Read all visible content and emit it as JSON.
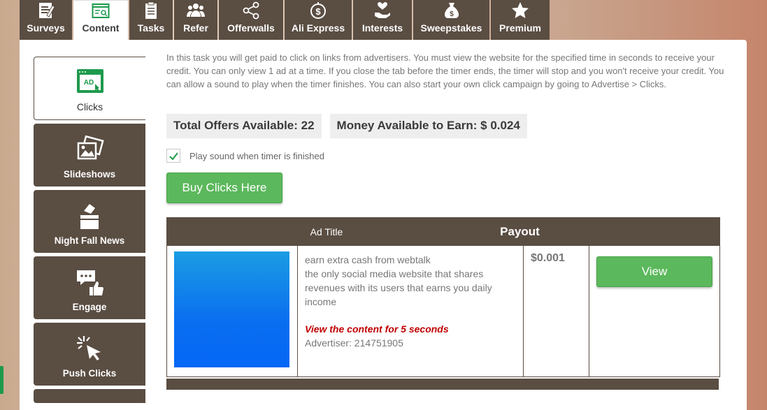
{
  "tabs": [
    {
      "label": "Surveys",
      "icon": "survey-icon"
    },
    {
      "label": "Content",
      "icon": "content-icon",
      "active": true
    },
    {
      "label": "Tasks",
      "icon": "clipboard-icon"
    },
    {
      "label": "Refer",
      "icon": "people-icon"
    },
    {
      "label": "Offerwalls",
      "icon": "share-icon"
    },
    {
      "label": "Ali Express",
      "icon": "dollar-circle-icon"
    },
    {
      "label": "Interests",
      "icon": "heart-hand-icon"
    },
    {
      "label": "Sweepstakes",
      "icon": "money-bag-icon"
    },
    {
      "label": "Premium",
      "icon": "star-icon"
    }
  ],
  "sidebar": {
    "items": [
      {
        "label": "Clicks",
        "icon": "ad-window-icon",
        "active": true
      },
      {
        "label": "Slideshows",
        "icon": "pictures-icon"
      },
      {
        "label": "Night Fall News",
        "icon": "ballot-box-icon"
      },
      {
        "label": "Engage",
        "icon": "chat-like-icon"
      },
      {
        "label": "Push Clicks",
        "icon": "cursor-click-icon"
      }
    ]
  },
  "intro": "In this task you will get paid to click on links from advertisers. You must view the website for the specified time in seconds to receive your credit. You can only view 1 ad at a time. If you close the tab before the timer ends, the timer will stop and you won't receive your credit. You can allow a sound to play when the timer finishes. You can also start your own click campaign by going to Advertise > Clicks.",
  "stats": {
    "offers": "Total Offers Available: 22",
    "money": "Money Available to Earn: $ 0.024"
  },
  "sound_label": "Play sound when timer is finished",
  "sound_checked": true,
  "buy_label": "Buy Clicks Here",
  "table": {
    "headers": {
      "title": "Ad Title",
      "payout": "Payout"
    },
    "rows": [
      {
        "title": "earn extra cash from webtalk",
        "description": "the only social media website that shares revenues with its users that earns you daily income",
        "view_note": "View the content for 5 seconds",
        "advertiser": "Advertiser: 214751905",
        "payout": "$0.001",
        "view_label": "View"
      }
    ]
  },
  "colors": {
    "brown": "#5a4d42",
    "green": "#5cb85c",
    "accent_green": "#1e9a4d",
    "red": "#c00000"
  }
}
